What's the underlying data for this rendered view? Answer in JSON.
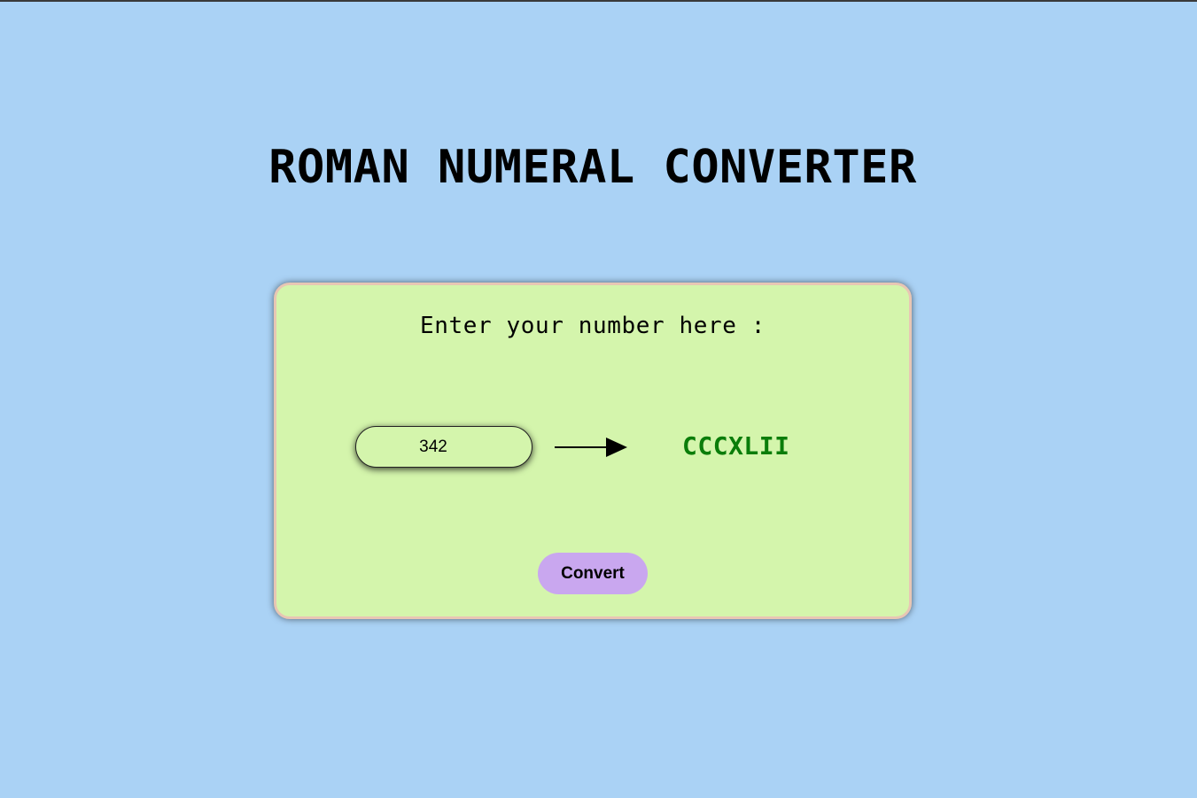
{
  "header": {
    "title": "ROMAN NUMERAL CONVERTER"
  },
  "converter": {
    "prompt": "Enter your number here :",
    "input_value": "342",
    "arrow_icon": "right-arrow-icon",
    "result": "CCCXLII",
    "convert_label": "Convert"
  },
  "colors": {
    "page_background": "#aad2f5",
    "card_background": "#d4f5ac",
    "card_border": "#e8c6b4",
    "result_text": "#0a7d0a",
    "button_background": "#c9a7ef"
  }
}
